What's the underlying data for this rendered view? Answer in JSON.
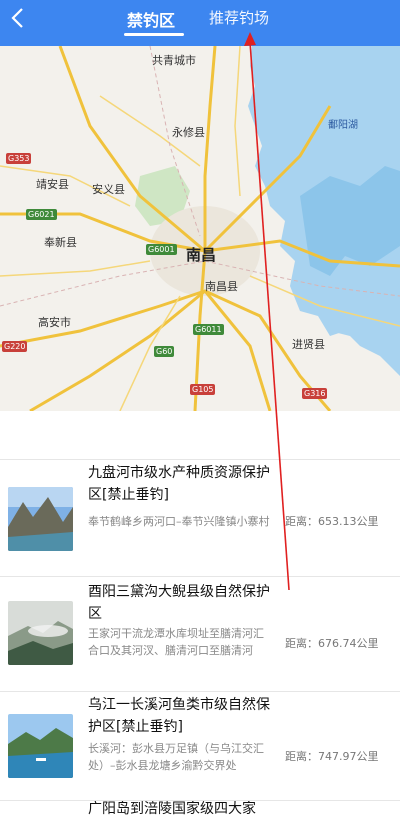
{
  "header": {
    "tabs": [
      {
        "label": "禁钓区"
      },
      {
        "label": "推荐钓场"
      }
    ]
  },
  "map": {
    "places": [
      {
        "name": "共青城市"
      },
      {
        "name": "永修县"
      },
      {
        "name": "鄱阳湖"
      },
      {
        "name": "靖安县"
      },
      {
        "name": "安义县"
      },
      {
        "name": "奉新县"
      },
      {
        "name": "南昌"
      },
      {
        "name": "南昌县"
      },
      {
        "name": "高安市"
      },
      {
        "name": "进贤县"
      }
    ],
    "shields": [
      "G353",
      "G6021",
      "G6001",
      "G220",
      "G6011",
      "G60",
      "G105",
      "G316"
    ]
  },
  "list": {
    "distance_prefix": "距离：",
    "items": [
      {
        "title": "九盘河市级水产种质资源保护区[禁止垂钓]",
        "desc": "奉节鹤峰乡两河口–奉节兴隆镇小寨村",
        "distance": "653.13公里"
      },
      {
        "title": "酉阳三黛沟大鲵县级自然保护区",
        "desc": "王家河干流龙潭水库坝址至膳清河汇合口及其河汊、膳清河口至膳清河",
        "distance": "676.74公里"
      },
      {
        "title": "乌江一长溪河鱼类市级自然保护区[禁止垂钓]",
        "desc": "长溪河：彭水县万足镇（与乌江交汇处）–彭水县龙塘乡渝黔交界处",
        "distance": "747.97公里"
      },
      {
        "title": "广阳岛到涪陵国家级四大家",
        "desc": "",
        "distance": ""
      }
    ]
  }
}
